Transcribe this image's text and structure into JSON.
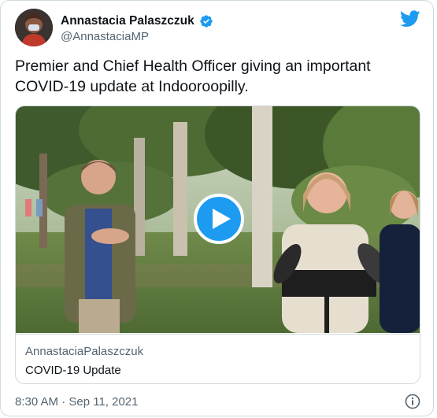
{
  "author": {
    "display_name": "Annastacia Palaszczuk",
    "handle": "@AnnastaciaMP",
    "verified": true
  },
  "tweet": {
    "text": "Premier and Chief Health Officer giving an important COVID-19 update at Indooroopilly."
  },
  "link_card": {
    "domain": "AnnastaciaPalaszczuk",
    "title": "COVID-19 Update"
  },
  "footer": {
    "timestamp": "8:30 AM · Sep 11, 2021"
  },
  "icons": {
    "brand": "twitter-bird-icon",
    "verified": "verified-badge-icon",
    "play": "play-icon",
    "info": "info-icon"
  },
  "colors": {
    "accent": "#1d9bf0",
    "text_primary": "#0f1419",
    "text_secondary": "#536471",
    "border": "#cfd9de"
  }
}
